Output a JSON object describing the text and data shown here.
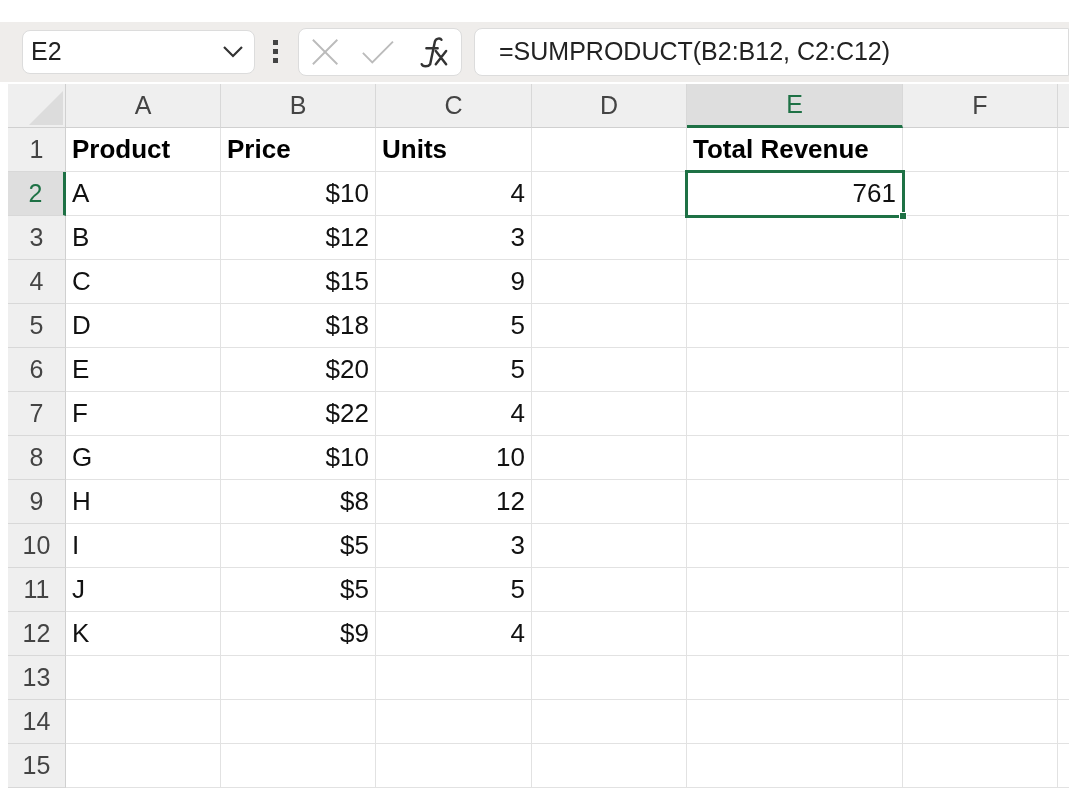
{
  "name_box": {
    "value": "E2"
  },
  "formula_bar": {
    "value": "=SUMPRODUCT(B2:B12, C2:C12)"
  },
  "columns": [
    {
      "label": "A",
      "selected": false
    },
    {
      "label": "B",
      "selected": false
    },
    {
      "label": "C",
      "selected": false
    },
    {
      "label": "D",
      "selected": false
    },
    {
      "label": "E",
      "selected": true
    },
    {
      "label": "F",
      "selected": false
    }
  ],
  "summary": {
    "label": "Total Revenue",
    "value": "761",
    "selected": true
  },
  "rows": [
    {
      "label": "1",
      "selected": false,
      "kind": "header",
      "cells": [
        "Product",
        "Price",
        "Units"
      ]
    },
    {
      "label": "2",
      "selected": true,
      "kind": "data",
      "cells": [
        "A",
        "$10",
        "4"
      ]
    },
    {
      "label": "3",
      "selected": false,
      "kind": "data",
      "cells": [
        "B",
        "$12",
        "3"
      ]
    },
    {
      "label": "4",
      "selected": false,
      "kind": "data",
      "cells": [
        "C",
        "$15",
        "9"
      ]
    },
    {
      "label": "5",
      "selected": false,
      "kind": "data",
      "cells": [
        "D",
        "$18",
        "5"
      ]
    },
    {
      "label": "6",
      "selected": false,
      "kind": "data",
      "cells": [
        "E",
        "$20",
        "5"
      ]
    },
    {
      "label": "7",
      "selected": false,
      "kind": "data",
      "cells": [
        "F",
        "$22",
        "4"
      ]
    },
    {
      "label": "8",
      "selected": false,
      "kind": "data",
      "cells": [
        "G",
        "$10",
        "10"
      ]
    },
    {
      "label": "9",
      "selected": false,
      "kind": "data",
      "cells": [
        "H",
        "$8",
        "12"
      ]
    },
    {
      "label": "10",
      "selected": false,
      "kind": "data",
      "cells": [
        "I",
        "$5",
        "3"
      ]
    },
    {
      "label": "11",
      "selected": false,
      "kind": "data",
      "cells": [
        "J",
        "$5",
        "5"
      ]
    },
    {
      "label": "12",
      "selected": false,
      "kind": "data",
      "cells": [
        "K",
        "$9",
        "4"
      ]
    },
    {
      "label": "13",
      "selected": false
    },
    {
      "label": "14",
      "selected": false
    },
    {
      "label": "15",
      "selected": false
    }
  ]
}
